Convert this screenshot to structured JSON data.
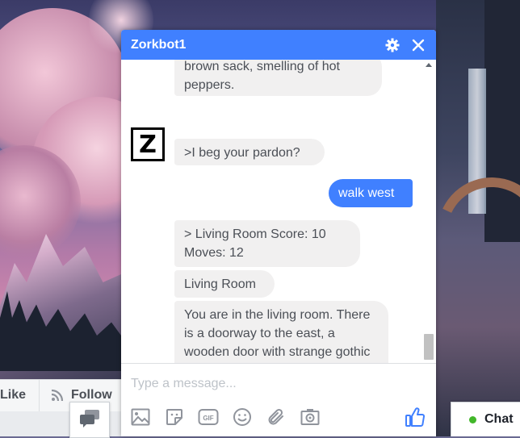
{
  "chat": {
    "title": "Zorkbot1",
    "avatar_letter": "Z",
    "messages": [
      {
        "from": "bot",
        "text": "brown sack, smelling of hot peppers."
      },
      {
        "from": "bot",
        "text": ">I beg your pardon?"
      },
      {
        "from": "user",
        "text": "walk west"
      },
      {
        "from": "bot",
        "text": "> Living Room Score: 10 Moves: 12"
      },
      {
        "from": "bot",
        "text": "Living Room"
      },
      {
        "from": "bot",
        "text": "You are in the living room. There is a doorway to the east, a wooden door with strange gothic lettering to the west, which appears to be"
      }
    ],
    "input_placeholder": "Type a message...",
    "toolbar_icons": [
      "image-icon",
      "sticker-icon",
      "gif-icon",
      "emoji-icon",
      "attachment-icon",
      "camera-icon",
      "thumbs-up-icon"
    ]
  },
  "page": {
    "like_label": "Like",
    "follow_label": "Follow"
  },
  "chat_tab": {
    "label": "Chat",
    "status_color": "#42b72a"
  },
  "colors": {
    "accent": "#4080ff",
    "bot_bubble": "#f1f0f0"
  }
}
